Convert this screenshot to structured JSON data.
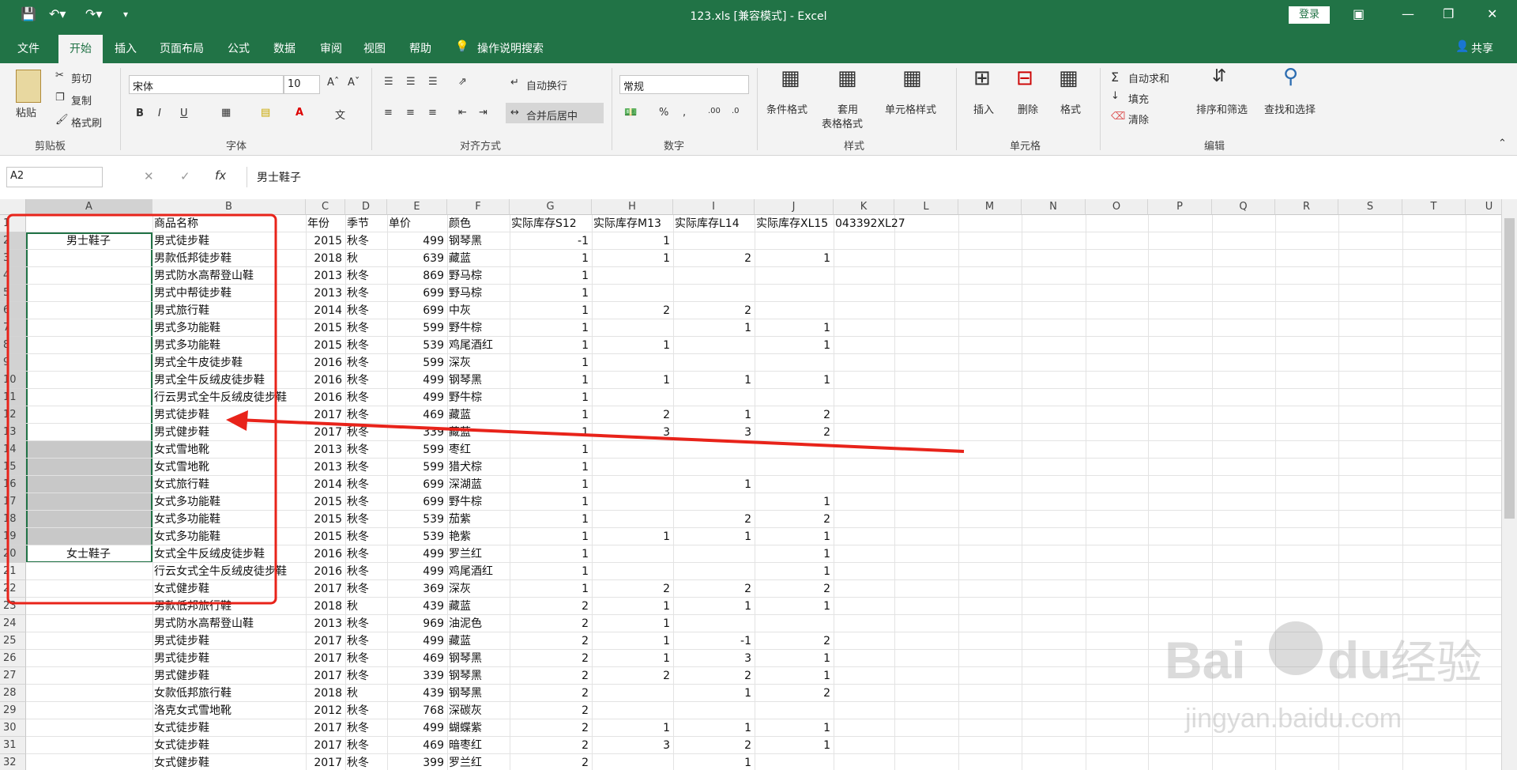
{
  "window": {
    "title": "123.xls  [兼容模式]  -  Excel",
    "login_label": "登录",
    "share_label": "共享"
  },
  "menu": [
    "文件",
    "开始",
    "插入",
    "页面布局",
    "公式",
    "数据",
    "审阅",
    "视图",
    "帮助"
  ],
  "tell_me": "操作说明搜索",
  "ribbon": {
    "clipboard": {
      "paste": "粘贴",
      "cut": "剪切",
      "copy": "复制",
      "format_painter": "格式刷",
      "label": "剪贴板"
    },
    "font": {
      "name": "宋体",
      "size": "10",
      "label": "字体"
    },
    "alignment": {
      "wrap": "自动换行",
      "merge": "合并后居中",
      "label": "对齐方式"
    },
    "number": {
      "format": "常规",
      "label": "数字"
    },
    "styles": {
      "conditional": "条件格式",
      "table_line1": "套用",
      "table_line2": "表格格式",
      "cell_styles": "单元格样式",
      "label": "样式"
    },
    "cells": {
      "insert": "插入",
      "delete": "删除",
      "format": "格式",
      "label": "单元格"
    },
    "editing": {
      "autosum": "自动求和",
      "fill": "填充",
      "clear": "清除",
      "sort_filter": "排序和筛选",
      "find_select": "查找和选择",
      "label": "编辑"
    }
  },
  "formula_bar": {
    "name_box": "A2",
    "fx": "fx",
    "content": "男士鞋子"
  },
  "columns": [
    "A",
    "B",
    "C",
    "D",
    "E",
    "F",
    "G",
    "H",
    "I",
    "J",
    "K",
    "L",
    "M",
    "N",
    "O",
    "P",
    "Q",
    "R",
    "S",
    "T",
    "U"
  ],
  "header_row": [
    "",
    "商品名称",
    "年份",
    "季节",
    "单价",
    "颜色",
    "实际库存S12",
    "实际库存M13",
    "实际库存L14",
    "实际库存XL15",
    "043392XL27"
  ],
  "rows": [
    [
      "男士鞋子",
      "男式徒步鞋",
      "2015",
      "秋冬",
      "499",
      "钢琴黑",
      "-1",
      "1",
      "",
      ""
    ],
    [
      "",
      "男款低邦徒步鞋",
      "2018",
      "秋",
      "639",
      "藏蓝",
      "1",
      "1",
      "2",
      "1"
    ],
    [
      "",
      "男式防水高帮登山鞋",
      "2013",
      "秋冬",
      "869",
      "野马棕",
      "1",
      "",
      "",
      ""
    ],
    [
      "",
      "男式中帮徒步鞋",
      "2013",
      "秋冬",
      "699",
      "野马棕",
      "1",
      "",
      "",
      ""
    ],
    [
      "",
      "男式旅行鞋",
      "2014",
      "秋冬",
      "699",
      "中灰",
      "1",
      "2",
      "2",
      ""
    ],
    [
      "",
      "男式多功能鞋",
      "2015",
      "秋冬",
      "599",
      "野牛棕",
      "1",
      "",
      "1",
      "1"
    ],
    [
      "",
      "男式多功能鞋",
      "2015",
      "秋冬",
      "539",
      "鸡尾酒红",
      "1",
      "1",
      "",
      "1"
    ],
    [
      "",
      "男式全牛皮徒步鞋",
      "2016",
      "秋冬",
      "599",
      "深灰",
      "1",
      "",
      "",
      ""
    ],
    [
      "",
      "男式全牛反绒皮徒步鞋",
      "2016",
      "秋冬",
      "499",
      "钢琴黑",
      "1",
      "1",
      "1",
      "1"
    ],
    [
      "",
      "行云男式全牛反绒皮徒步鞋",
      "2016",
      "秋冬",
      "499",
      "野牛棕",
      "1",
      "",
      "",
      ""
    ],
    [
      "",
      "男式徒步鞋",
      "2017",
      "秋冬",
      "469",
      "藏蓝",
      "1",
      "2",
      "1",
      "2"
    ],
    [
      "",
      "男式健步鞋",
      "2017",
      "秋冬",
      "339",
      "藏蓝",
      "1",
      "3",
      "3",
      "2"
    ],
    [
      "",
      "女式雪地靴",
      "2013",
      "秋冬",
      "599",
      "枣红",
      "1",
      "",
      "",
      ""
    ],
    [
      "",
      "女式雪地靴",
      "2013",
      "秋冬",
      "599",
      "猎犬棕",
      "1",
      "",
      "",
      ""
    ],
    [
      "",
      "女式旅行鞋",
      "2014",
      "秋冬",
      "699",
      "深湖蓝",
      "1",
      "",
      "1",
      ""
    ],
    [
      "",
      "女式多功能鞋",
      "2015",
      "秋冬",
      "699",
      "野牛棕",
      "1",
      "",
      "",
      "1"
    ],
    [
      "",
      "女式多功能鞋",
      "2015",
      "秋冬",
      "539",
      "茄紫",
      "1",
      "",
      "2",
      "2"
    ],
    [
      "",
      "女式多功能鞋",
      "2015",
      "秋冬",
      "539",
      "艳紫",
      "1",
      "1",
      "1",
      "1"
    ],
    [
      "女士鞋子",
      "女式全牛反绒皮徒步鞋",
      "2016",
      "秋冬",
      "499",
      "罗兰红",
      "1",
      "",
      "",
      "1"
    ],
    [
      "",
      "行云女式全牛反绒皮徒步鞋",
      "2016",
      "秋冬",
      "499",
      "鸡尾酒红",
      "1",
      "",
      "",
      "1"
    ],
    [
      "",
      "女式健步鞋",
      "2017",
      "秋冬",
      "369",
      "深灰",
      "1",
      "2",
      "2",
      "2"
    ],
    [
      "",
      "男款低邦旅行鞋",
      "2018",
      "秋",
      "439",
      "藏蓝",
      "2",
      "1",
      "1",
      "1"
    ],
    [
      "",
      "男式防水高帮登山鞋",
      "2013",
      "秋冬",
      "969",
      "油泥色",
      "2",
      "1",
      "",
      ""
    ],
    [
      "",
      "男式徒步鞋",
      "2017",
      "秋冬",
      "499",
      "藏蓝",
      "2",
      "1",
      "-1",
      "2"
    ],
    [
      "",
      "男式徒步鞋",
      "2017",
      "秋冬",
      "469",
      "钢琴黑",
      "2",
      "1",
      "3",
      "1"
    ],
    [
      "",
      "男式健步鞋",
      "2017",
      "秋冬",
      "339",
      "钢琴黑",
      "2",
      "2",
      "2",
      "1"
    ],
    [
      "",
      "女款低邦旅行鞋",
      "2018",
      "秋",
      "439",
      "钢琴黑",
      "2",
      "",
      "1",
      "2"
    ],
    [
      "",
      "洛克女式雪地靴",
      "2012",
      "秋冬",
      "768",
      "深碳灰",
      "2",
      "",
      "",
      ""
    ],
    [
      "",
      "女式徒步鞋",
      "2017",
      "秋冬",
      "499",
      "蝴蝶紫",
      "2",
      "1",
      "1",
      "1"
    ],
    [
      "",
      "女式徒步鞋",
      "2017",
      "秋冬",
      "469",
      "暗枣红",
      "2",
      "3",
      "2",
      "1"
    ],
    [
      "",
      "女式健步鞋",
      "2017",
      "秋冬",
      "399",
      "罗兰红",
      "2",
      "",
      "1",
      ""
    ]
  ],
  "watermark": {
    "line1": "Bai",
    "line2": "du",
    "cn": "经验",
    "url": "jingyan.baidu.com"
  },
  "colors": {
    "excel_green": "#217346",
    "annotation_red": "#e8231a",
    "selection_gray": "#c8c8c8"
  }
}
